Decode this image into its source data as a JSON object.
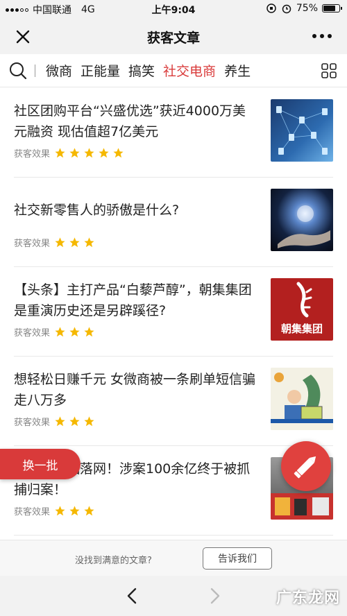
{
  "status_bar": {
    "carrier": "中国联通",
    "network": "4G",
    "time": "上午9:04",
    "battery": "75%",
    "battery_level": 0.75
  },
  "nav": {
    "title": "获客文章",
    "close_icon": "close-icon",
    "more_icon": "more-icon"
  },
  "tabs": {
    "items": [
      "微商",
      "正能量",
      "搞笑",
      "社交电商",
      "养生"
    ],
    "active": "社交电商",
    "active_color": "#d93a3a"
  },
  "articles": [
    {
      "title": "社区团购平台“兴盛优选”获近4000万美元融资 现估值超7亿美元",
      "meta_label": "获客效果",
      "rating": 5,
      "thumb_icon": "network-graph-image"
    },
    {
      "title": "社交新零售人的骄傲是什么?",
      "meta_label": "获客效果",
      "rating": 3,
      "thumb_icon": "glowing-hand-image"
    },
    {
      "title": "【头条】主打产品“白藜芦醇”，朝集集团是重演历史还是另辟蹊径?",
      "meta_label": "获客效果",
      "rating": 3,
      "thumb_icon": "brand-logo-image",
      "thumb_text": "朝集集团"
    },
    {
      "title": "想轻松日赚千元 女微商被一条刷单短信骗走八万多",
      "meta_label": "获客效果",
      "rating": 3,
      "thumb_icon": "cartoon-image"
    },
    {
      "title": "主谋金家福落网！涉案100余亿终于被抓捕归案！",
      "meta_label": "获客效果",
      "rating": 3,
      "thumb_icon": "street-photo-image"
    }
  ],
  "fab": {
    "refresh_label": "换一批",
    "edit_icon": "pencil-icon"
  },
  "feedback": {
    "prompt": "没找到满意的文章?",
    "button": "告诉我们"
  },
  "browser": {
    "back_icon": "chevron-left-icon",
    "forward_icon": "chevron-right-icon",
    "watermark": "广东龙网"
  },
  "colors": {
    "accent": "#d93a3a",
    "star": "#f5b800"
  }
}
